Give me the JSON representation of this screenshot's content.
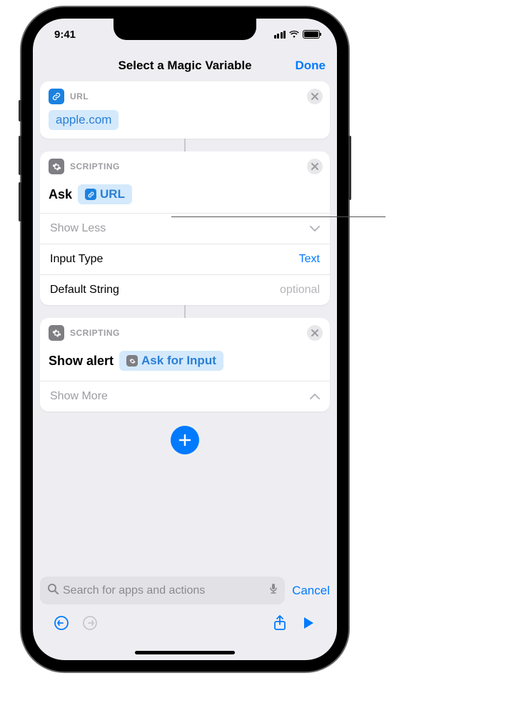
{
  "status": {
    "time": "9:41"
  },
  "nav": {
    "title": "Select a Magic Variable",
    "done": "Done"
  },
  "card_url": {
    "title": "URL",
    "chip": "apple.com"
  },
  "card_scripting1": {
    "title": "SCRIPTING",
    "ask_label": "Ask",
    "ask_variable": "URL",
    "show_less": "Show Less",
    "input_type_label": "Input Type",
    "input_type_value": "Text",
    "default_string_label": "Default String",
    "default_string_placeholder": "optional"
  },
  "card_scripting2": {
    "title": "SCRIPTING",
    "alert_label": "Show alert",
    "alert_variable": "Ask for Input",
    "show_more": "Show More"
  },
  "search": {
    "placeholder": "Search for apps and actions",
    "cancel": "Cancel"
  }
}
